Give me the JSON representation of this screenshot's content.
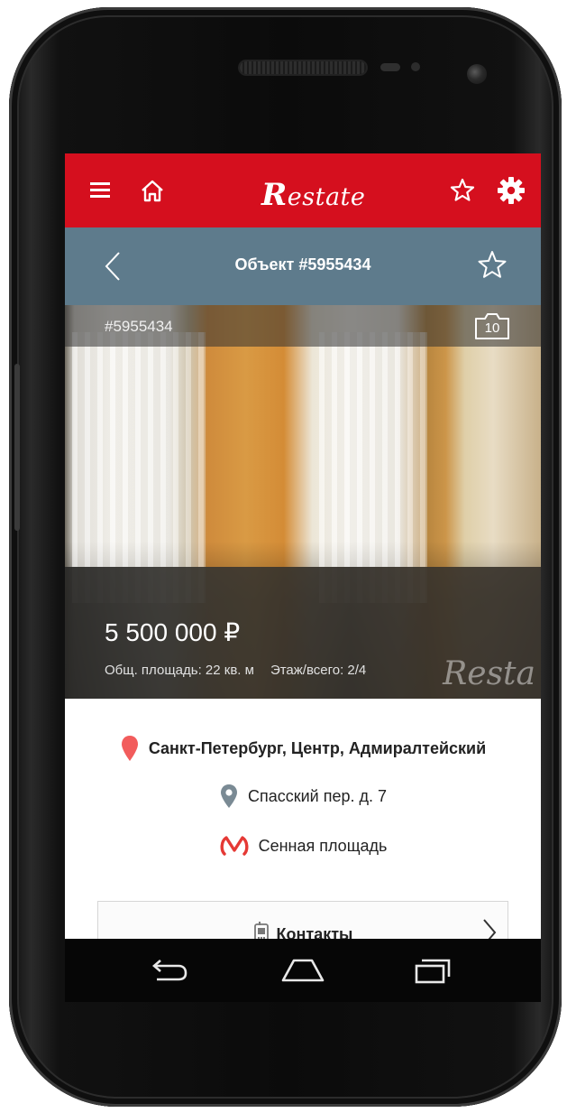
{
  "appbar": {
    "logo_initial": "R",
    "logo_rest": "estate",
    "menu_icon": "menu-icon",
    "home_icon": "home-icon",
    "favorite_icon": "star-outline-icon",
    "settings_icon": "gear-icon",
    "color": "#d50f1e"
  },
  "subbar": {
    "title": "Объект #5955434",
    "back_icon": "chevron-left-icon",
    "favorite_icon": "star-outline-icon",
    "color": "#5e7b8c"
  },
  "photo": {
    "object_id": "#5955434",
    "photo_count": "10",
    "price": "5 500 000 ₽",
    "area": "Общ. площадь: 22  кв. м",
    "floor": "Этаж/всего: 2/4",
    "watermark": "Resta"
  },
  "location": {
    "region": "Санкт-Петербург, Центр, Адмиралтейский",
    "address": "Спасский пер.  д. 7",
    "metro": "Сенная площадь",
    "metro_color": "#e53935",
    "pin_color": "#f25c5c"
  },
  "contacts": {
    "label": "Контакты"
  },
  "navbar": {
    "back_icon": "back-arrow-icon",
    "home_icon": "home-outline-icon",
    "recents_icon": "recents-icon"
  }
}
